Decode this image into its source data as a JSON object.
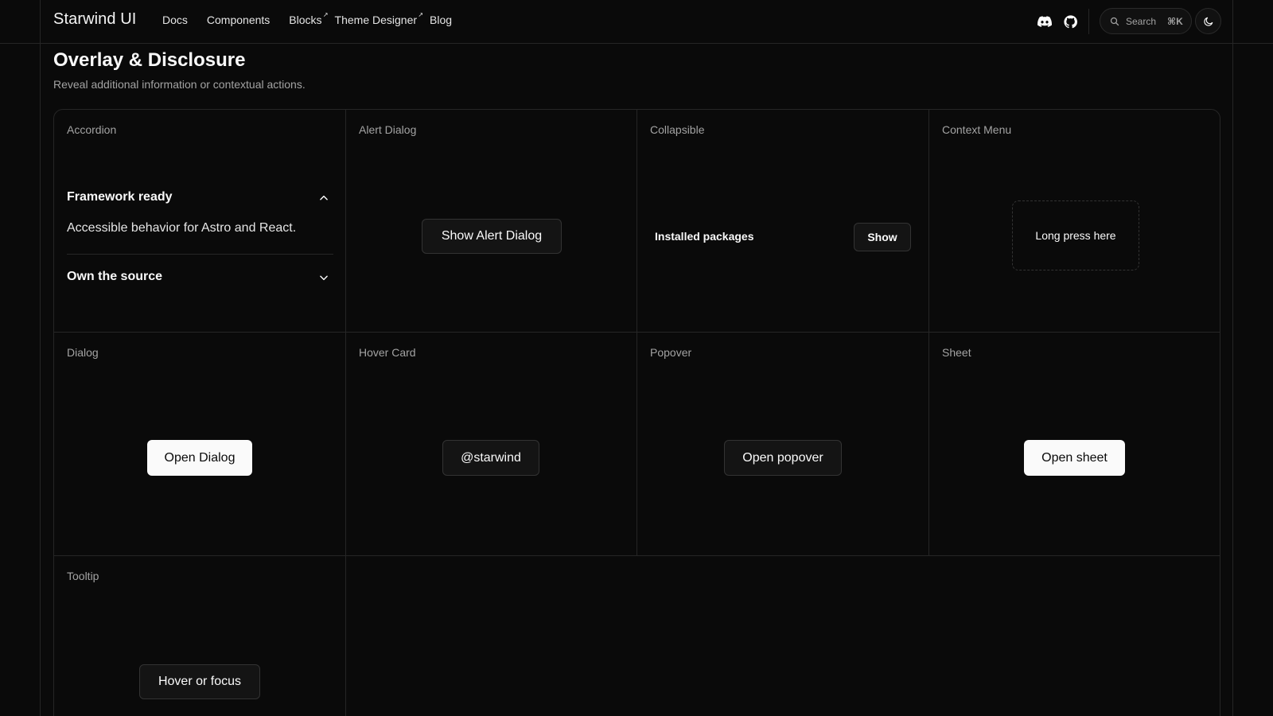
{
  "header": {
    "brand": "Starwind UI",
    "nav": [
      {
        "label": "Docs"
      },
      {
        "label": "Components"
      },
      {
        "label": "Blocks",
        "external": true
      },
      {
        "label": "Theme Designer",
        "external": true
      },
      {
        "label": "Blog"
      }
    ],
    "external_marker": "↗",
    "icons": [
      "discord-icon",
      "github-icon",
      "moon-icon",
      "search-icon"
    ],
    "search": {
      "label": "Search",
      "shortcut": "⌘K"
    }
  },
  "section": {
    "title": "Overlay & Disclosure",
    "subtitle": "Reveal additional information or contextual actions."
  },
  "cells": {
    "accordion": {
      "label": "Accordion",
      "items": [
        {
          "title": "Framework ready",
          "content": "Accessible behavior for Astro and React.",
          "expanded": true
        },
        {
          "title": "Own the source",
          "expanded": false
        }
      ]
    },
    "alert_dialog": {
      "label": "Alert Dialog",
      "button": "Show Alert Dialog"
    },
    "collapsible": {
      "label": "Collapsible",
      "text": "Installed packages",
      "button": "Show"
    },
    "context_menu": {
      "label": "Context Menu",
      "area": "Long press here"
    },
    "dialog": {
      "label": "Dialog",
      "button": "Open Dialog"
    },
    "hover_card": {
      "label": "Hover Card",
      "button": "@starwind"
    },
    "popover": {
      "label": "Popover",
      "button": "Open popover"
    },
    "sheet": {
      "label": "Sheet",
      "button": "Open sheet"
    },
    "tooltip": {
      "label": "Tooltip",
      "button": "Hover or focus"
    }
  },
  "colors": {
    "background": "#0a0a0a",
    "border": "#262626",
    "muted_text": "#a3a3a3",
    "foreground": "#fafafa"
  }
}
